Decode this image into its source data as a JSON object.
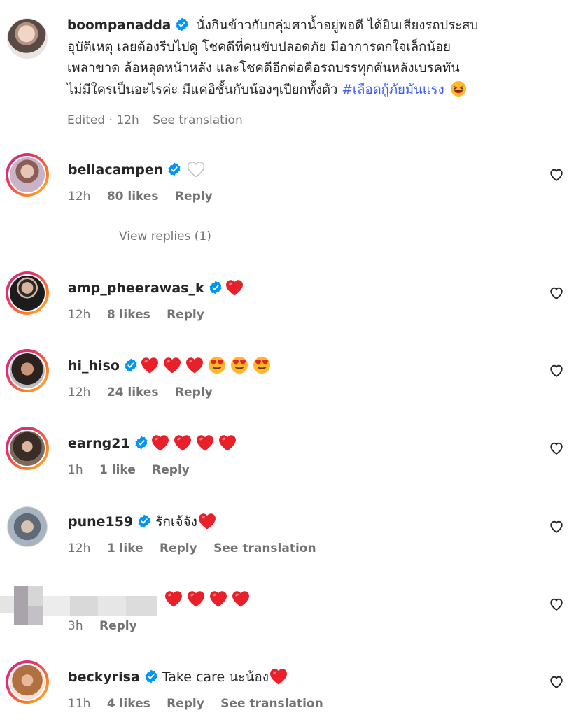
{
  "caption": {
    "username": "boompanadda",
    "lines": [
      "นั่งกินข้าวกับกลุ่มศาน้ำอยู่พอดี ได้ยินเสียงรถประสบ",
      "อุบัติเหตุ เลยต้องรีบไปดู โชคดีที่คนขับปลอดภัย มีอาการตกใจเล็กน้อย",
      "เพลาขาด ล้อหลุดหน้าหลัง และโชคดีอีกต่อคือรถบรรทุกคันหลังเบรคทัน",
      "ไม่มีใครเป็นอะไรค่ะ มีแค่อิชั้นกับน้องๆเปียกทั้งตัว"
    ],
    "hashtag": "#เลือดกู้ภัยมันแรง",
    "edited_label": "Edited · 12h",
    "see_translation": "See translation"
  },
  "view_replies": "View replies (1)",
  "comments": [
    {
      "username": "bellacampen",
      "text": "",
      "time": "12h",
      "likes": "80 likes",
      "reply": "Reply",
      "see_translation": ""
    },
    {
      "username": "amp_pheerawas_k",
      "text": "",
      "time": "12h",
      "likes": "8 likes",
      "reply": "Reply",
      "see_translation": ""
    },
    {
      "username": "hi_hiso",
      "text": "",
      "time": "12h",
      "likes": "24 likes",
      "reply": "Reply",
      "see_translation": ""
    },
    {
      "username": "earng21",
      "text": "",
      "time": "1h",
      "likes": "1 like",
      "reply": "Reply",
      "see_translation": ""
    },
    {
      "username": "pune159",
      "text": "รักเจ้จัง",
      "time": "12h",
      "likes": "1 like",
      "reply": "Reply",
      "see_translation": "See translation"
    },
    {
      "username": "",
      "text": "",
      "time": "3h",
      "likes": "",
      "reply": "Reply",
      "see_translation": ""
    },
    {
      "username": "beckyrisa",
      "text": "Take care นะน้อง",
      "time": "11h",
      "likes": "4 likes",
      "reply": "Reply",
      "see_translation": "See translation"
    }
  ],
  "colors": {
    "verified": "#0095f6",
    "heart_emoji": "#e8202a",
    "hashtag": "#3d5afe",
    "meta_gray": "#737373"
  }
}
